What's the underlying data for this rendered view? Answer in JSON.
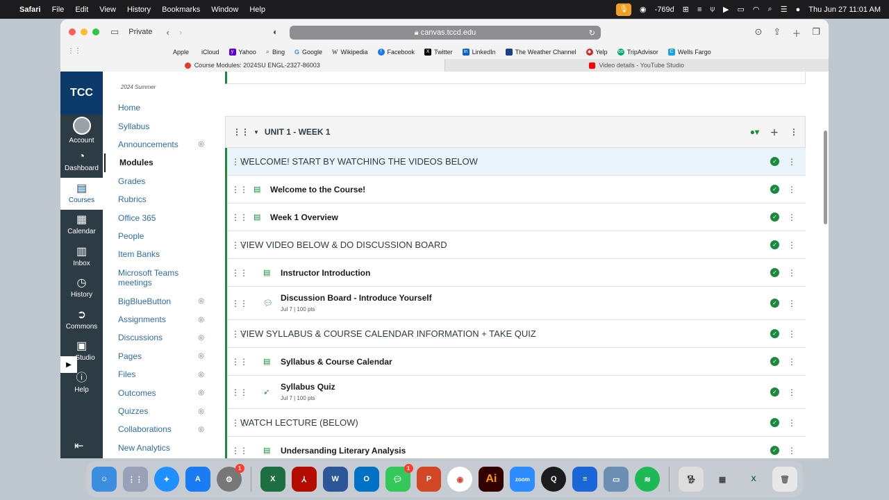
{
  "menubar": {
    "app": "Safari",
    "menus": [
      "File",
      "Edit",
      "View",
      "History",
      "Bookmarks",
      "Window",
      "Help"
    ],
    "battery_text": "-769d",
    "datetime": "Thu Jun 27  11:01 AM"
  },
  "browser": {
    "private_label": "Private",
    "url": "canvas.tccd.edu",
    "favorites": [
      "Apple",
      "iCloud",
      "Yahoo",
      "Bing",
      "Google",
      "Wikipedia",
      "Facebook",
      "Twitter",
      "LinkedIn",
      "The Weather Channel",
      "Yelp",
      "TripAdvisor",
      "Wells Fargo"
    ],
    "tabs": [
      {
        "title": "Course Modules: 2024SU ENGL-2327-86003"
      },
      {
        "title": "Video details - YouTube Studio"
      }
    ]
  },
  "global_nav": {
    "logo": "TCC",
    "items": [
      "Account",
      "Dashboard",
      "Courses",
      "Calendar",
      "Inbox",
      "History",
      "Commons",
      "Studio",
      "Help"
    ]
  },
  "course_nav": {
    "term": "2024 Summer",
    "items": [
      "Home",
      "Syllabus",
      "Announcements",
      "Modules",
      "Grades",
      "Rubrics",
      "Office 365",
      "People",
      "Item Banks",
      "Microsoft Teams meetings",
      "BigBlueButton",
      "Assignments",
      "Discussions",
      "Pages",
      "Files",
      "Outcomes",
      "Quizzes",
      "Collaborations",
      "New Analytics"
    ]
  },
  "module": {
    "title": "UNIT 1 - WEEK 1",
    "rows": [
      {
        "title": "WELCOME! START BY WATCHING THE VIDEOS BELOW"
      },
      {
        "title": "Welcome to the Course!"
      },
      {
        "title": "Week 1 Overview"
      },
      {
        "title": "VIEW VIDEO BELOW & DO DISCUSSION BOARD"
      },
      {
        "title": "Instructor Introduction"
      },
      {
        "title": "Discussion Board - Introduce Yourself",
        "meta": "Jul 7  |  100 pts"
      },
      {
        "title": "VIEW SYLLABUS & COURSE CALENDAR INFORMATION + TAKE QUIZ"
      },
      {
        "title": "Syllabus & Course Calendar"
      },
      {
        "title": "Syllabus Quiz",
        "meta": "Jul 7  |  100 pts"
      },
      {
        "title": "WATCH LECTURE (BELOW)"
      },
      {
        "title": "Undersanding Literary Analysis"
      }
    ]
  },
  "dock": {
    "badges": {
      "settings": "1",
      "messages": "1"
    },
    "labels": {
      "adobe_illustrator": "Ai",
      "zoom": "zoom"
    }
  }
}
